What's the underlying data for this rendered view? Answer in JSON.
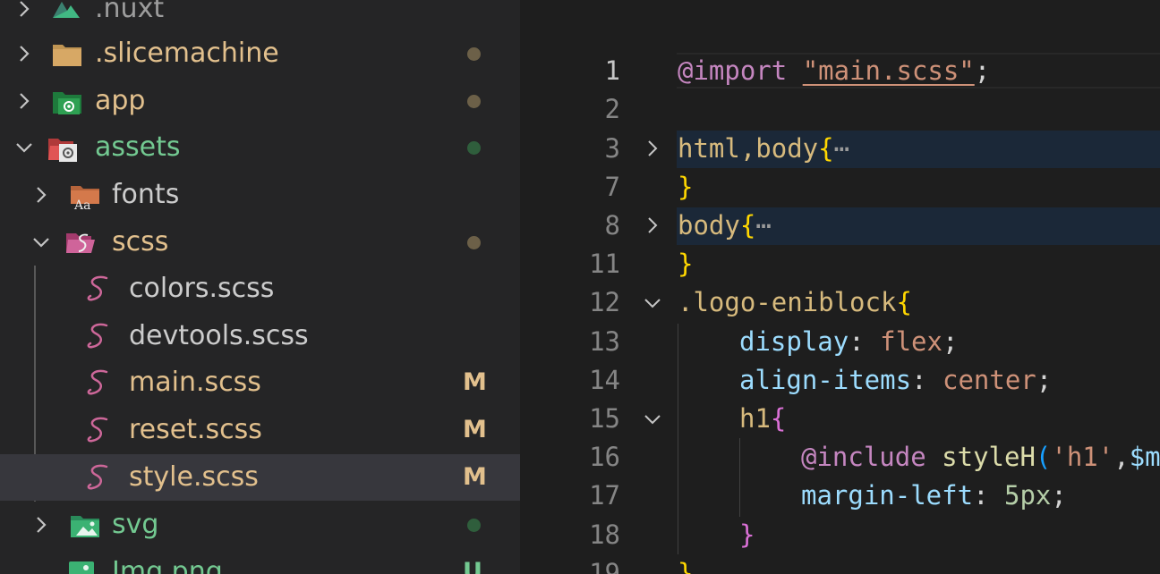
{
  "explorer": {
    "items": [
      {
        "name": ".nuxt",
        "color": "#9d9d9d"
      },
      {
        "name": ".slicemachine",
        "color": "#e2c08d",
        "status": "dot",
        "status_color": "#6c6048"
      },
      {
        "name": "app",
        "color": "#e2c08d",
        "status": "dot",
        "status_color": "#6c6048"
      },
      {
        "name": "assets",
        "color": "#73c991",
        "status": "dot",
        "status_color": "#2f5e3c"
      },
      {
        "name": "fonts",
        "color": "#cccccc"
      },
      {
        "name": "scss",
        "color": "#e2c08d",
        "status": "dot",
        "status_color": "#6c6048"
      },
      {
        "name": "colors.scss",
        "color": "#cccccc"
      },
      {
        "name": "devtools.scss",
        "color": "#cccccc"
      },
      {
        "name": "main.scss",
        "color": "#e2c08d",
        "status": "M"
      },
      {
        "name": "reset.scss",
        "color": "#e2c08d",
        "status": "M"
      },
      {
        "name": "style.scss",
        "color": "#e2c08d",
        "status": "M"
      },
      {
        "name": "svg",
        "color": "#73c991",
        "status": "dot",
        "status_color": "#2f5e3c"
      },
      {
        "name": "Img.png",
        "color": "#73c991",
        "status": "U"
      }
    ]
  },
  "editor": {
    "line_numbers": [
      "1",
      "2",
      "3",
      "7",
      "8",
      "11",
      "12",
      "13",
      "14",
      "15",
      "16",
      "17",
      "18",
      "19"
    ],
    "active_line": "1",
    "code": {
      "l1_at": "@import",
      "l1_str": "\"main.scss\"",
      "l1_semi": ";",
      "l3_sel": "html,body",
      "l3_br": "{",
      "l3_dots": "⋯",
      "l7_br": "}",
      "l8_sel": "body",
      "l8_br": "{",
      "l8_dots": "⋯",
      "l11_br": "}",
      "l12_sel": ".logo-eniblock",
      "l12_br": "{",
      "l13_prop": "display",
      "l13_colon": ": ",
      "l13_val": "flex",
      "l13_semi": ";",
      "l14_prop": "align-items",
      "l14_colon": ": ",
      "l14_val": "center",
      "l14_semi": ";",
      "l15_tag": "h1",
      "l15_br": "{",
      "l16_at": "@include",
      "l16_fn": "styleH",
      "l16_paren": "(",
      "l16_arg": "'h1'",
      "l16_comma": ",",
      "l16_var": "$ma",
      "l17_prop": "margin-left",
      "l17_colon": ": ",
      "l17_num": "5px",
      "l17_semi": ";",
      "l18_br": "}",
      "l19_br": "}"
    }
  }
}
